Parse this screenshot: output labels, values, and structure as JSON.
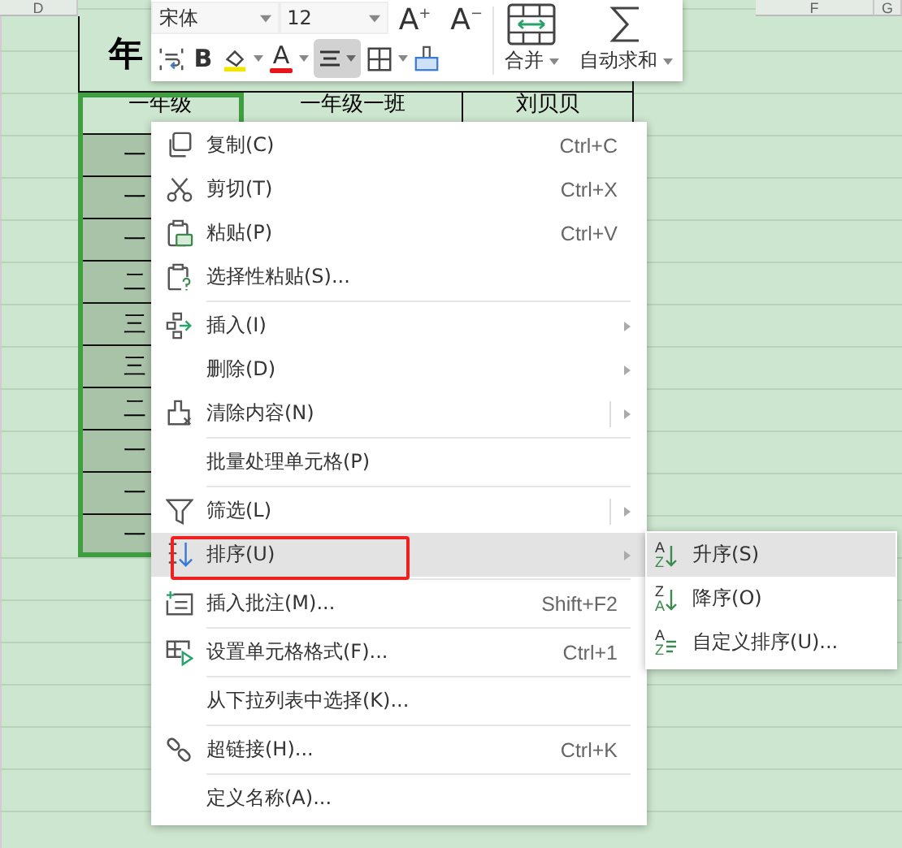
{
  "sheet": {
    "column_headers": [
      "D",
      "F",
      "G"
    ],
    "table": {
      "title": "年",
      "header_row": [
        "一年级",
        "一年级一班",
        "刘贝贝"
      ],
      "first_column": [
        "一",
        "一",
        "一",
        "二",
        "三",
        "三",
        "二",
        "一",
        "一",
        "一"
      ]
    }
  },
  "toolbar": {
    "font_name": "宋体",
    "font_size": "12",
    "grow_font": "A$^{+}$",
    "shrink_font": "A$^{−}$",
    "bold": "B",
    "font_color": "A",
    "align_selected": true,
    "merge": "合并",
    "autosum": "自动求和"
  },
  "context_menu": {
    "groups": [
      [
        {
          "label": "复制(C)",
          "shortcut": "Ctrl+C",
          "submenu": false,
          "split": false,
          "selected": false,
          "annotated": false
        },
        {
          "label": "剪切(T)",
          "shortcut": "Ctrl+X",
          "submenu": false,
          "split": false,
          "selected": false,
          "annotated": false
        },
        {
          "label": "粘贴(P)",
          "shortcut": "Ctrl+V",
          "submenu": false,
          "split": false,
          "selected": false,
          "annotated": false
        },
        {
          "label": "选择性粘贴(S)...",
          "submenu": false,
          "split": false,
          "selected": false,
          "annotated": false
        }
      ],
      [
        {
          "label": "插入(I)",
          "submenu": true,
          "split": false,
          "selected": false,
          "annotated": false
        },
        {
          "label": "删除(D)",
          "submenu": true,
          "split": false,
          "selected": false,
          "annotated": false
        },
        {
          "label": "清除内容(N)",
          "submenu": true,
          "split": true,
          "selected": false,
          "annotated": false
        }
      ],
      [
        {
          "label": "批量处理单元格(P)",
          "submenu": false,
          "split": false,
          "selected": false,
          "annotated": false
        }
      ],
      [
        {
          "label": "筛选(L)",
          "submenu": true,
          "split": true,
          "selected": false,
          "annotated": false
        },
        {
          "label": "排序(U)",
          "submenu": true,
          "split": false,
          "selected": true,
          "annotated": true
        }
      ],
      [
        {
          "label": "插入批注(M)...",
          "shortcut": "Shift+F2",
          "submenu": false,
          "split": false,
          "selected": false,
          "annotated": false
        }
      ],
      [
        {
          "label": "设置单元格格式(F)...",
          "shortcut": "Ctrl+1",
          "submenu": false,
          "split": false,
          "selected": false,
          "annotated": false
        }
      ],
      [
        {
          "label": "从下拉列表中选择(K)...",
          "submenu": false,
          "split": false,
          "selected": false,
          "annotated": false
        }
      ],
      [
        {
          "label": "超链接(H)...",
          "shortcut": "Ctrl+K",
          "submenu": false,
          "split": false,
          "selected": false,
          "annotated": false
        }
      ],
      [
        {
          "label": "定义名称(A)...",
          "submenu": false,
          "split": false,
          "selected": false,
          "annotated": false
        }
      ]
    ]
  },
  "sort_submenu": [
    {
      "label": "升序(S)",
      "icon_letters": [
        "A",
        "Z"
      ],
      "kind": "arrow",
      "selected": true
    },
    {
      "label": "降序(O)",
      "icon_letters": [
        "Z",
        "A"
      ],
      "kind": "arrow",
      "selected": false
    },
    {
      "label": "自定义排序(U)...",
      "icon_letters": [
        "A",
        "Z"
      ],
      "kind": "lines",
      "selected": false
    }
  ]
}
